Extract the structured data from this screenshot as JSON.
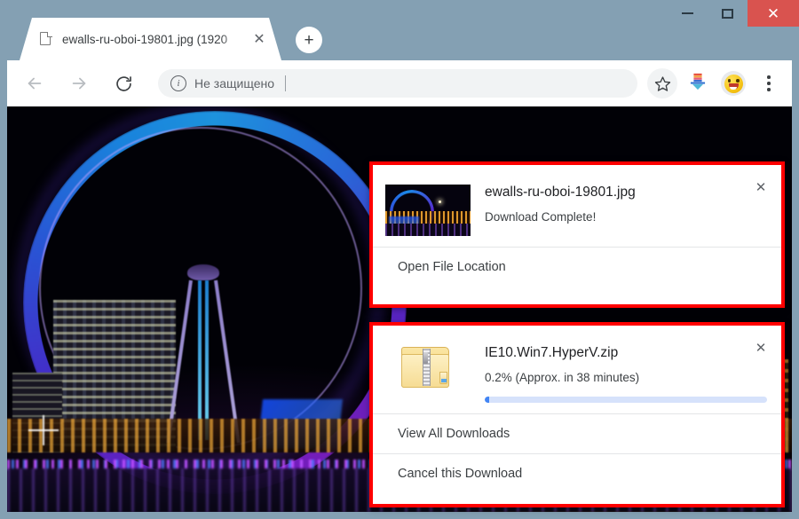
{
  "window": {
    "controls": {
      "minimize": "–",
      "maximize": "❐",
      "close": "✕"
    }
  },
  "tabstrip": {
    "tab": {
      "title": "ewalls-ru-oboi-19801.jpg (1920",
      "favicon": "document-icon",
      "close_label": "✕"
    },
    "new_tab_label": "+"
  },
  "toolbar": {
    "back_label": "back-arrow",
    "forward_label": "forward-arrow",
    "reload_label": "reload-arrow",
    "omnibox": {
      "security_icon": "info-icon",
      "security_label": "Не защищено",
      "value": "",
      "placeholder": ""
    },
    "bookmark_label": "star-icon",
    "extension_label": "download-extension-icon",
    "profile_label": "smiley-avatar",
    "menu_label": "three-dot-menu"
  },
  "page": {
    "image_alt": "London Eye ferris wheel illuminated blue and purple at night over the River Thames"
  },
  "downloads": {
    "highlight_color": "#ff0000",
    "progress_color": "#4285f4",
    "progress_track_color": "#d6e2fb",
    "panels": [
      {
        "id": "complete",
        "icon": "image-thumbnail",
        "filename": "ewalls-ru-oboi-19801.jpg",
        "status": "Download Complete!",
        "close_label": "✕",
        "has_progress": false,
        "actions": [
          "Open File Location"
        ]
      },
      {
        "id": "progress",
        "icon": "zip-folder-icon",
        "filename": "IE10.Win7.HyperV.zip",
        "status": "0.2% (Approx. in 38 minutes)",
        "close_label": "✕",
        "has_progress": true,
        "progress_percent": 0.2,
        "actions": [
          "View All Downloads",
          "Cancel this Download"
        ]
      }
    ]
  }
}
